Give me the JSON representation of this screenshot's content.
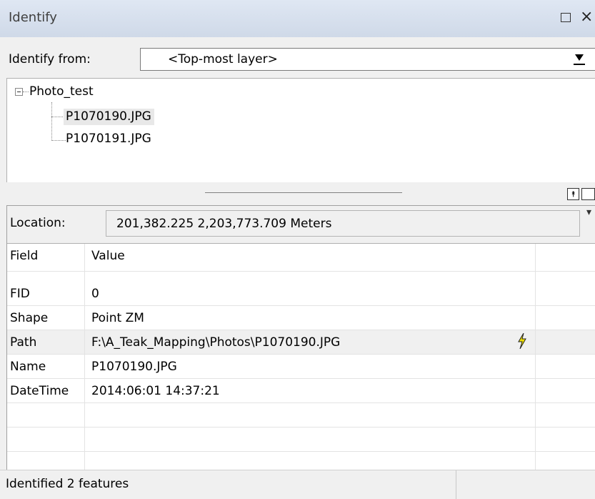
{
  "window": {
    "title": "Identify",
    "close_glyph": "×"
  },
  "identify_from": {
    "label": "Identify from:",
    "value": "<Top-most layer>"
  },
  "tree": {
    "root": "Photo_test",
    "children": [
      "P1070190.JPG",
      "P1070191.JPG"
    ],
    "selected_index": 0
  },
  "location": {
    "label": "Location:",
    "value": "201,382.225  2,203,773.709 Meters"
  },
  "table": {
    "headers": [
      "Field",
      "Value"
    ],
    "rows": [
      {
        "field": "FID",
        "value": "0"
      },
      {
        "field": "Shape",
        "value": "Point ZM"
      },
      {
        "field": "Path",
        "value": "F:\\A_Teak_Mapping\\Photos\\P1070190.JPG"
      },
      {
        "field": "Name",
        "value": "P1070190.JPG"
      },
      {
        "field": "DateTime",
        "value": "2014:06:01 14:37:21"
      }
    ],
    "selected_row": 2
  },
  "status": {
    "text": "Identified 2 features"
  },
  "icons": {
    "maximize": "maximize-icon",
    "close": "close-icon",
    "dropdown": "chevron-down-icon",
    "expander": "collapse-icon",
    "hyperlink": "lightning-icon",
    "pin": "pin-icon"
  },
  "colors": {
    "titlebar": "#d6dfec",
    "selection": "#e8e8e8",
    "lightning": "#f0e000"
  }
}
